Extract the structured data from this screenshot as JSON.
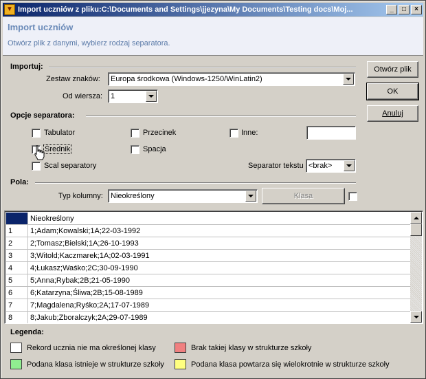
{
  "window": {
    "title": "Import uczniów z pliku:C:\\Documents and Settings\\jjezyna\\My Documents\\Testing docs\\Moj...",
    "minimize": "_",
    "maximize": "□",
    "close": "×"
  },
  "header": {
    "title": "Import uczniów",
    "subtitle": "Otwórz plik z danymi, wybierz rodzaj separatora."
  },
  "importuj": {
    "group_label": "Importuj:",
    "charset_label": "Zestaw znaków:",
    "charset_value": "Europa środkowa (Windows-1250/WinLatin2)",
    "from_row_label": "Od wiersza:",
    "from_row_value": "1"
  },
  "separator": {
    "group_label": "Opcje separatora:",
    "tabulator": "Tabulator",
    "przecinek": "Przecinek",
    "inne": "Inne:",
    "srednik": "Średnik",
    "spacja": "Spacja",
    "scal": "Scal separatory",
    "text_sep_label": "Separator tekstu",
    "text_sep_value": "<brak>"
  },
  "pola": {
    "group_label": "Pola:",
    "column_type_label": "Typ kolumny:",
    "column_type_value": "Nieokreślony",
    "klasa_button": "Klasa"
  },
  "buttons": {
    "open_file": "Otwórz plik",
    "ok": "OK",
    "cancel": "Anuluj"
  },
  "grid": {
    "header_col": "Nieokreślony",
    "rows": [
      {
        "num": "1",
        "value": "1;Adam;Kowalski;1A;22-03-1992"
      },
      {
        "num": "2",
        "value": "2;Tomasz;Bielski;1A;26-10-1993"
      },
      {
        "num": "3",
        "value": "3;Witold;Kaczmarek;1A;02-03-1991"
      },
      {
        "num": "4",
        "value": "4;Łukasz;Waśko;2C;30-09-1990"
      },
      {
        "num": "5",
        "value": "5;Anna;Rybak;2B;21-05-1990"
      },
      {
        "num": "6",
        "value": "6;Katarzyna;Śliwa;2B;15-08-1989"
      },
      {
        "num": "7",
        "value": "7;Magdalena;Ryśko;2A;17-07-1989"
      },
      {
        "num": "8",
        "value": "8;Jakub;Zboralczyk;2A;29-07-1989"
      }
    ]
  },
  "legend": {
    "title": "Legenda:",
    "items": [
      {
        "label": "Rekord ucznia nie ma określonej klasy",
        "color": "#ffffff"
      },
      {
        "label": "Brak takiej klasy w strukturze szkoły",
        "color": "#f08080"
      },
      {
        "label": "Podana klasa istnieje w strukturze szkoły",
        "color": "#90ee90"
      },
      {
        "label": "Podana klasa powtarza się wielokrotnie w strukturze szkoły",
        "color": "#ffff80"
      }
    ]
  }
}
